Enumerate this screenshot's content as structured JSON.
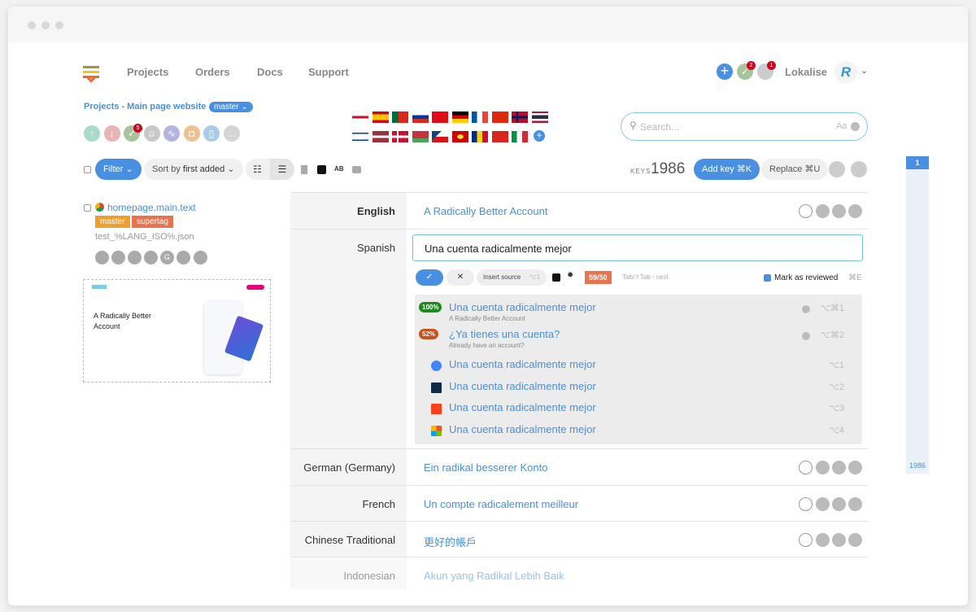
{
  "nav": {
    "items": [
      "Projects",
      "Orders",
      "Docs",
      "Support"
    ],
    "account": "Lokalise",
    "notif_tasks": "2",
    "notif_comments": "1"
  },
  "project": {
    "breadcrumb": "Projects - Main page website",
    "branch": "master",
    "tasks_badge": "5"
  },
  "flags": [
    "gb",
    "es",
    "pt",
    "ru",
    "tr",
    "de",
    "fr",
    "cn",
    "no",
    "th",
    "il",
    "lv",
    "dk",
    "by",
    "cz",
    "mk",
    "ro",
    "vn",
    "it"
  ],
  "search": {
    "placeholder": "Search...",
    "case_label": "Aa"
  },
  "toolbar": {
    "filter": "Filter",
    "sort_prefix": "Sort by ",
    "sort_value": "first added",
    "keys_label": "KEYS",
    "keys_count": "1986",
    "add_key": "Add key ⌘K",
    "replace": "Replace ⌘U"
  },
  "key": {
    "name": "homepage.main.text",
    "tags": [
      "master",
      "supertag"
    ],
    "filename": "test_%LANG_ISO%.json",
    "preview_title": "A Radically Better Account"
  },
  "rows": [
    {
      "lang": "English",
      "text": "A Radically Better Account"
    },
    {
      "lang": "Spanish",
      "text": "Una cuenta radicalmente mejor"
    },
    {
      "lang": "German (Germany)",
      "text": "Ein radikal besserer Konto"
    },
    {
      "lang": "French",
      "text": "Un compte radicalement meilleur"
    },
    {
      "lang": "Chinese Traditional",
      "text": "更好的帳戶"
    },
    {
      "lang": "Indonesian",
      "text": "Akun yang Radikal Lebih Baik"
    }
  ],
  "editor": {
    "insert_source": "Insert source",
    "insert_shortcut": "⌥1",
    "char_count": "59/50",
    "hint": "Tab/⇧Tab - next",
    "mark_reviewed": "Mark as reviewed",
    "mark_shortcut": "⌘E"
  },
  "suggestions": [
    {
      "match": "100%",
      "text": "Una cuenta radicalmente mejor",
      "source": "A Radically Better Account",
      "shortcut": "⌥⌘1",
      "color": "#1e8a1e"
    },
    {
      "match": "52%",
      "text": "¿Ya tienes una cuenta?",
      "source": "Already have an account?",
      "shortcut": "⌥⌘2",
      "color": "#c9521c"
    },
    {
      "provider": "google",
      "text": "Una cuenta radicalmente mejor",
      "shortcut": "⌥1"
    },
    {
      "provider": "deepl",
      "text": "Una cuenta radicalmente mejor",
      "shortcut": "⌥2"
    },
    {
      "provider": "yandex",
      "text": "Una cuenta radicalmente mejor",
      "shortcut": "⌥3"
    },
    {
      "provider": "microsoft",
      "text": "Una cuenta radicalmente mejor",
      "shortcut": "⌥4"
    }
  ],
  "scroller": {
    "top": "1",
    "bottom": "1986"
  }
}
